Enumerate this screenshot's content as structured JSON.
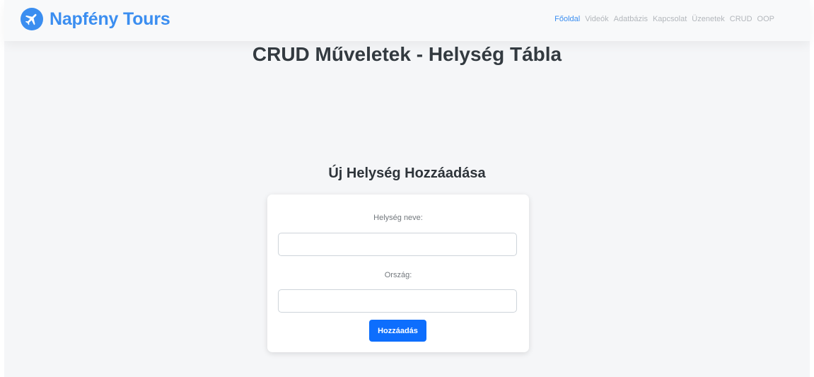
{
  "navbar": {
    "brand_name": "Napfény Tours",
    "brand_icon": "airplane-icon",
    "links": [
      {
        "label": "Főoldal",
        "active": true
      },
      {
        "label": "Videók",
        "active": false
      },
      {
        "label": "Adatbázis",
        "active": false
      },
      {
        "label": "Kapcsolat",
        "active": false
      },
      {
        "label": "Üzenetek",
        "active": false
      },
      {
        "label": "CRUD",
        "active": false
      },
      {
        "label": "OOP",
        "active": false
      }
    ]
  },
  "page": {
    "title": "CRUD Műveletek - Helység Tábla"
  },
  "form": {
    "title": "Új Helység Hozzáadása",
    "city_label": "Helység neve:",
    "city_value": "",
    "country_label": "Ország:",
    "country_value": "",
    "submit_label": "Hozzáadás"
  },
  "colors": {
    "brand": "#3b8ef0",
    "primary_button": "#0d6efd",
    "nav_inactive": "#b3b7bc"
  }
}
